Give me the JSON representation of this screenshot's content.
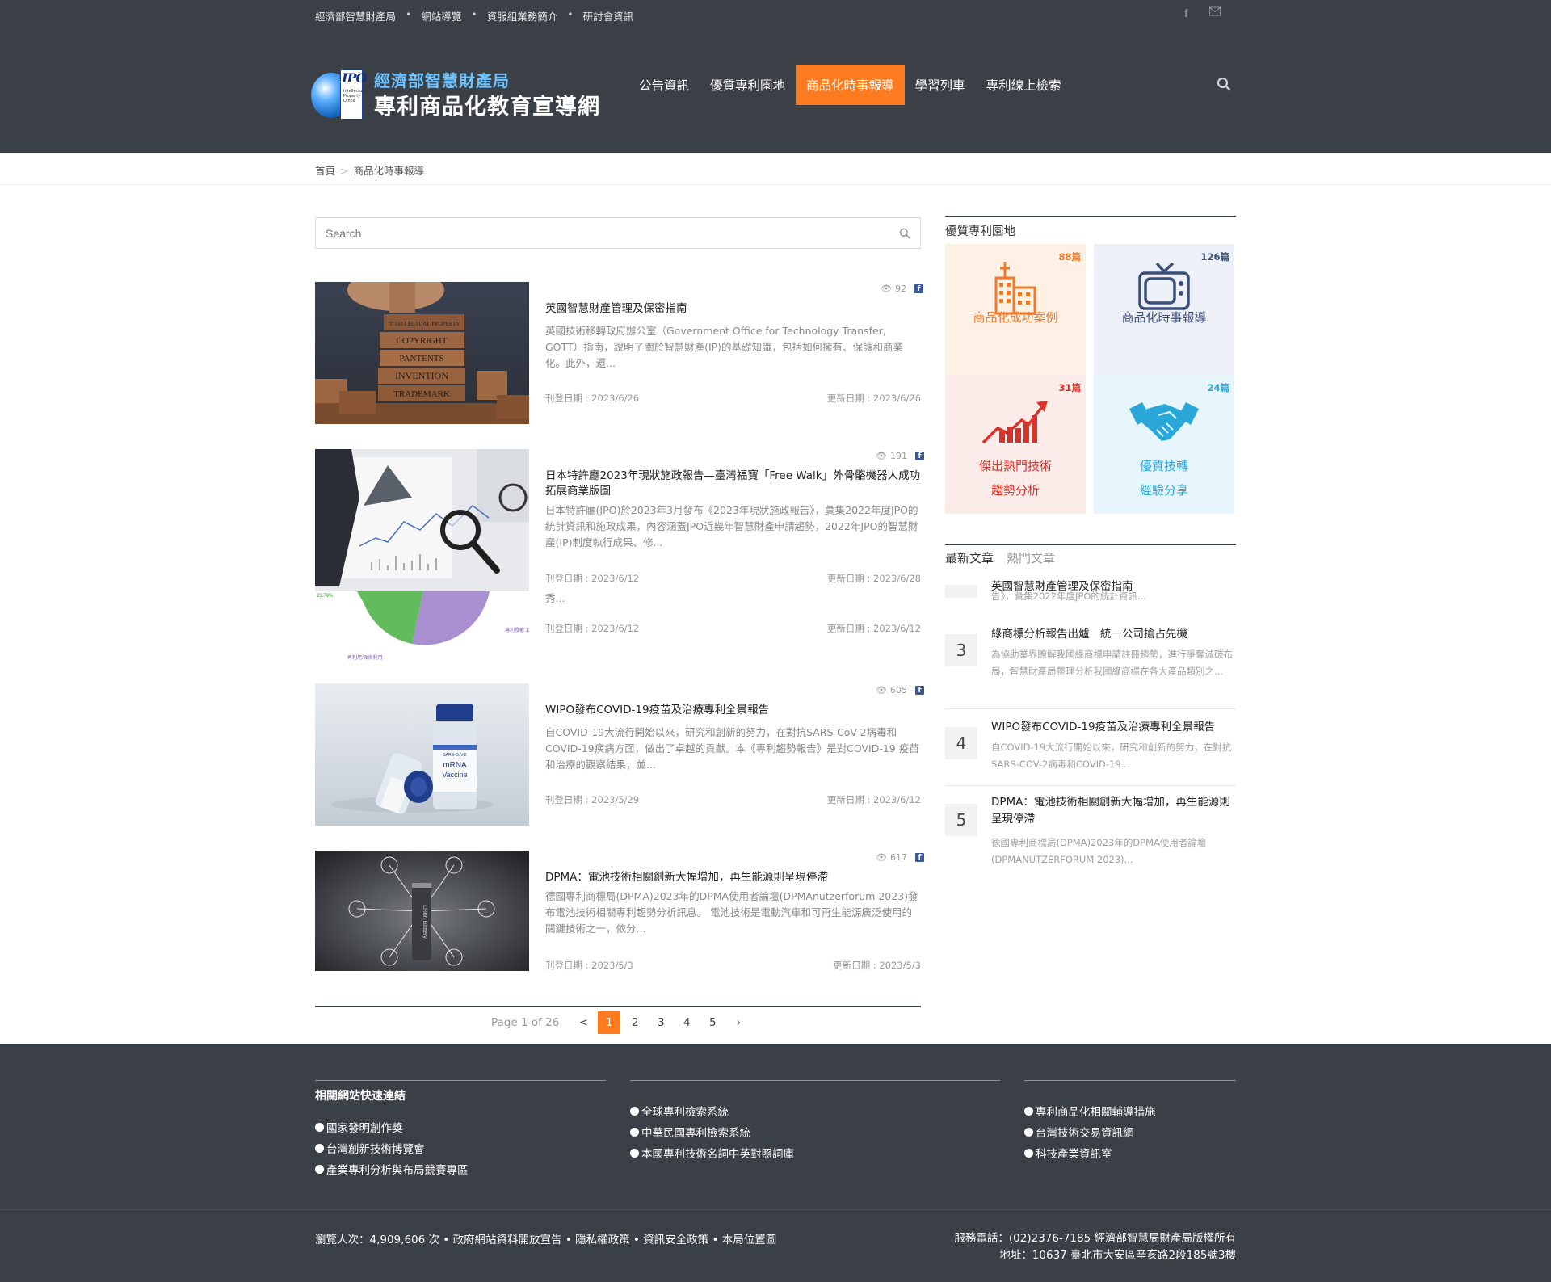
{
  "topbar": {
    "links": [
      "經濟部智慧財產局",
      "網站導覽",
      "資服組業務簡介",
      "研討會資訊"
    ],
    "icons": [
      "facebook-icon",
      "mail-icon"
    ]
  },
  "logo": {
    "ipo_text": "IPO",
    "line1": "經濟部智慧財產局",
    "line2": "專利商品化教育宣導網",
    "small_text": "Intellectual Property Office"
  },
  "nav": {
    "items": [
      "公告資訊",
      "優質專利園地",
      "商品化時事報導",
      "學習列車",
      "專利線上檢索"
    ],
    "active_index": 2
  },
  "breadcrumb": {
    "home": "首頁",
    "separator": ">",
    "current": "商品化時事報導"
  },
  "search": {
    "placeholder": "Search"
  },
  "posts": [
    {
      "views": "92",
      "title": "英國智慧財產管理及保密指南",
      "desc": "英國技術移轉政府辦公室（Government Office for Technology Transfer, GOTT）指南，說明了關於智慧財產(IP)的基礎知識，包括如何擁有、保護和商業化。此外，還...",
      "published": "刊登日期 : 2023/6/26",
      "updated": "更新日期 : 2023/6/26",
      "thumb_words": [
        "INTELLECTUAL PROPERTY",
        "COPYRIGHT",
        "PANTENTS",
        "INVENTION",
        "TRADEMARK"
      ]
    },
    {
      "views": "191",
      "title": "日本特許廳2023年現狀施政報告—臺灣福寶「Free Walk」外骨骼機器人成功拓展商業版圖",
      "desc": "日本特許廳(JPO)於2023年3月發布《2023年現狀施政報告》，彙集2022年度JPO的統計資訊和施政成果，內容涵蓋JPO近幾年智慧財產申請趨勢，2022年JPO的智慧財產(IP)制度執行成果、修...",
      "published": "刊登日期 : 2023/6/12",
      "updated": "更新日期 : 2023/6/28",
      "overlap_text": "秀...",
      "overlap_published": "刊登日期 : 2023/6/12",
      "overlap_updated": "更新日期 : 2023/6/12",
      "pie_labels": [
        "23.79%",
        "專利授權 11.48%",
        "再利用/改良利用"
      ]
    },
    {
      "views": "605",
      "title": "WIPO發布COVID-19疫苗及治療專利全景報告",
      "desc": "自COVID-19大流行開始以來，研究和創新的努力，在對抗SARS-CoV-2病毒和COVID-19疾病方面，做出了卓越的貢獻。本《專利趨勢報告》是對COVID-19 疫苗和治療的觀察結果，並...",
      "published": "刊登日期 : 2023/5/29",
      "updated": "更新日期 : 2023/6/12",
      "thumb_words": [
        "SARS-CoV-2",
        "mRNA",
        "Vaccine"
      ]
    },
    {
      "views": "617",
      "title": "DPMA：電池技術相關創新大幅增加，再生能源則呈現停滯",
      "desc": "德國專利商標局(DPMA)2023年的DPMA使用者論壇(DPMAnutzerforum 2023)發布電池技術相關專利趨勢分析訊息。 電池技術是電動汽車和可再生能源廣泛使用的關鍵技術之一，依分...",
      "published": "刊登日期 : 2023/5/3",
      "updated": "更新日期 : 2023/5/3",
      "thumb_words": [
        "Li-Ion Battery"
      ]
    }
  ],
  "pagination": {
    "info": "Page 1 of 26",
    "prev": "<",
    "pages": [
      "1",
      "2",
      "3",
      "4",
      "5"
    ],
    "current": "1",
    "next": "›"
  },
  "sidebar": {
    "title": "優質專利園地",
    "tiles": [
      {
        "count": "88篇",
        "label1": "商品化成功案例",
        "label2": "",
        "icon": "buildings-icon",
        "bg": "#fdf0e4",
        "color": "#f07a2a"
      },
      {
        "count": "126篇",
        "label1": "商品化時事報導",
        "label2": "",
        "icon": "tv-icon",
        "bg": "#eef0f7",
        "color": "#3b4e7a"
      },
      {
        "count": "31篇",
        "label1": "傑出熱門技術",
        "label2": "趨勢分析",
        "icon": "growth-chart-icon",
        "bg": "#fbece9",
        "color": "#d9322b"
      },
      {
        "count": "24篇",
        "label1": "優質技轉",
        "label2": "經驗分享",
        "icon": "handshake-icon",
        "bg": "#e7f6fc",
        "color": "#2aa7d9"
      }
    ],
    "tabs": [
      "最新文章",
      "熱門文章"
    ],
    "active_tab": 0,
    "ranked": [
      {
        "num": "",
        "title": "英國智慧財產管理及保密指南",
        "desc": "告》，彙集2022年度JPO的統計資訊..."
      },
      {
        "num": "3",
        "title": "綠商標分析報告出爐　統一公司搶占先機",
        "desc": "為協助業界瞭解我國綠商標申請註冊趨勢，進行爭奪減碳布局，智慧財產局整理分析我國綠商標在各大產品類別之..."
      },
      {
        "num": "4",
        "title": "WIPO發布COVID-19疫苗及治療專利全景報告",
        "desc": "自COVID-19大流行開始以來，研究和創新的努力，在對抗SARS-COV-2病毒和COVID-19..."
      },
      {
        "num": "5",
        "title": "DPMA：電池技術相關創新大幅增加，再生能源則呈現停滯",
        "desc": "德國專利商標局(DPMA)2023年的DPMA使用者論壇(DPMANUTZERFORUM 2023)..."
      }
    ]
  },
  "footer": {
    "heading": "相關網站快速連結",
    "col1": [
      "國家發明創作獎",
      "台灣創新技術博覽會",
      "產業專利分析與布局競賽專區"
    ],
    "col2": [
      "全球專利檢索系統",
      "中華民國專利檢索系統",
      "本國專利技術名詞中英對照詞庫"
    ],
    "col3": [
      "專利商品化相關輔導措施",
      "台灣技術交易資訊網",
      "科技產業資訊室"
    ],
    "visitors": "瀏覽人次：4,909,606 次",
    "links": [
      "政府網站資料開放宣告",
      "隱私權政策",
      "資訊安全政策",
      "本局位置圖"
    ],
    "service": "服務電話：(02)2376-7185 經濟部智慧局財產局版權所有",
    "address": "地址：10637 臺北市大安區辛亥路2段185號3樓"
  }
}
